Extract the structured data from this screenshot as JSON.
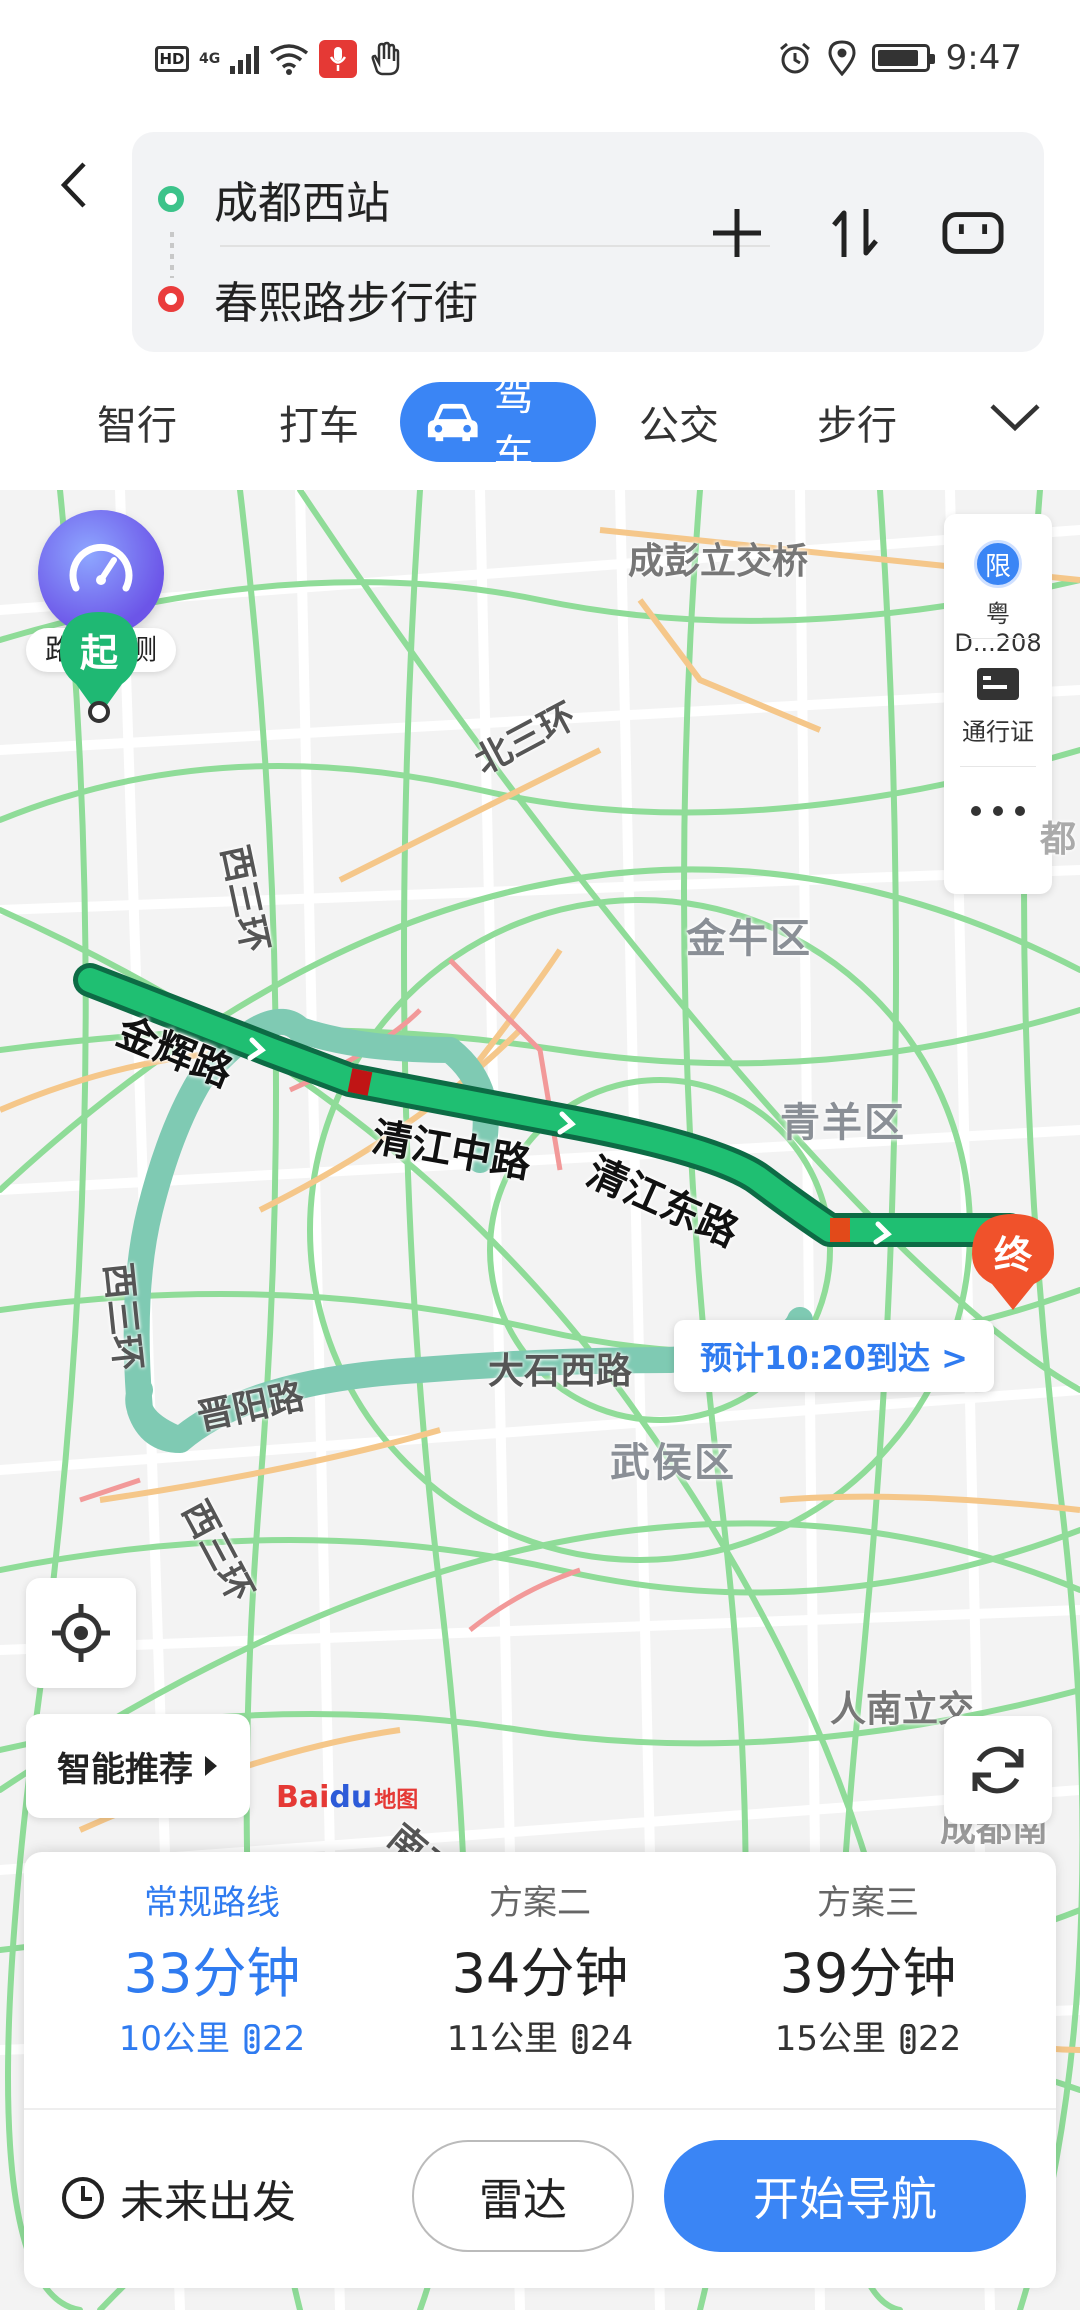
{
  "status_bar": {
    "hd": "HD",
    "network": "4G",
    "time": "9:47",
    "icons": [
      "hd-icon",
      "signal-icon",
      "wifi-icon",
      "mic-icon",
      "hand-icon",
      "alarm-icon",
      "location-icon",
      "battery-icon"
    ]
  },
  "route": {
    "origin": "成都西站",
    "destination": "春熙路步行街",
    "actions": [
      "add-stop-icon",
      "swap-icon",
      "vehicle-plate-icon"
    ]
  },
  "tabs": [
    {
      "label": "智行"
    },
    {
      "label": "打车"
    },
    {
      "label": "驾车",
      "active": true
    },
    {
      "label": "公交"
    },
    {
      "label": "步行"
    }
  ],
  "map": {
    "traffic_forecast": "路况预测",
    "side_panel": {
      "limit_badge": "限",
      "plate": "粤D...208",
      "pass_label": "通行证"
    },
    "district_labels": [
      "金牛区",
      "青羊区",
      "武侯区"
    ],
    "place_labels": [
      "成彭立交桥",
      "人南立交",
      "成都南"
    ],
    "ring_labels": [
      "北三环",
      "西三环",
      "西三环",
      "西三环",
      "南三环"
    ],
    "road_labels": [
      "晋阳路",
      "大石西路"
    ],
    "route_labels": [
      "金辉路",
      "清江中路",
      "清江东路"
    ],
    "start_pin": "起",
    "end_pin": "终",
    "eta": "预计10:20到达 >",
    "smart_recommend": "智能推荐",
    "logo": {
      "bai": "Bai",
      "du": "du",
      "ditu": "地图"
    },
    "edge_partial_label": "都"
  },
  "plans": [
    {
      "name": "常规路线",
      "time": "33分钟",
      "distance": "10公里",
      "lights": "22",
      "active": true
    },
    {
      "name": "方案二",
      "time": "34分钟",
      "distance": "11公里",
      "lights": "24",
      "active": false
    },
    {
      "name": "方案三",
      "time": "39分钟",
      "distance": "15公里",
      "lights": "22",
      "active": false
    }
  ],
  "bottom": {
    "future": "未来出发",
    "radar": "雷达",
    "navigate": "开始导航"
  },
  "colors": {
    "accent": "#3a85f5",
    "route_green": "#1fbf72",
    "alt_route": "#7fcab3",
    "congestion_red": "#c01515"
  }
}
